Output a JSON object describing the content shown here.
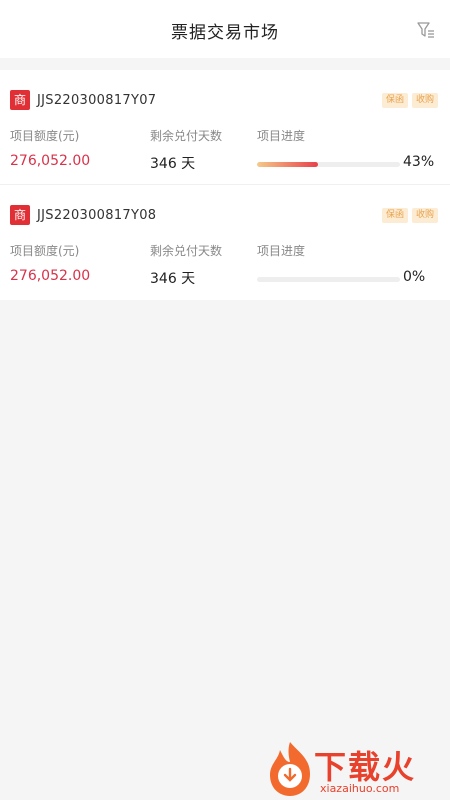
{
  "header": {
    "title": "票据交易市场",
    "filter_icon": "filter-icon"
  },
  "items": [
    {
      "badge": "商",
      "code": "JJS220300817Y07",
      "tags": [
        "保函",
        "收购"
      ],
      "amount_label": "项目额度(元)",
      "amount": "276,052.00",
      "days_label": "剩余兑付天数",
      "days": "346 天",
      "progress_label": "项目进度",
      "progress": 43,
      "progress_text": "43%"
    },
    {
      "badge": "商",
      "code": "JJS220300817Y08",
      "tags": [
        "保函",
        "收购"
      ],
      "amount_label": "项目额度(元)",
      "amount": "276,052.00",
      "days_label": "剩余兑付天数",
      "days": "346 天",
      "progress_label": "项目进度",
      "progress": 0,
      "progress_text": "0%"
    }
  ],
  "watermark": {
    "text": "下载火",
    "sub": "xiazaihuo.com"
  },
  "colors": {
    "accent": "#e02f35",
    "amount": "#d7334a",
    "tag_bg": "#fcecd3",
    "tag_text": "#e9a24e"
  }
}
